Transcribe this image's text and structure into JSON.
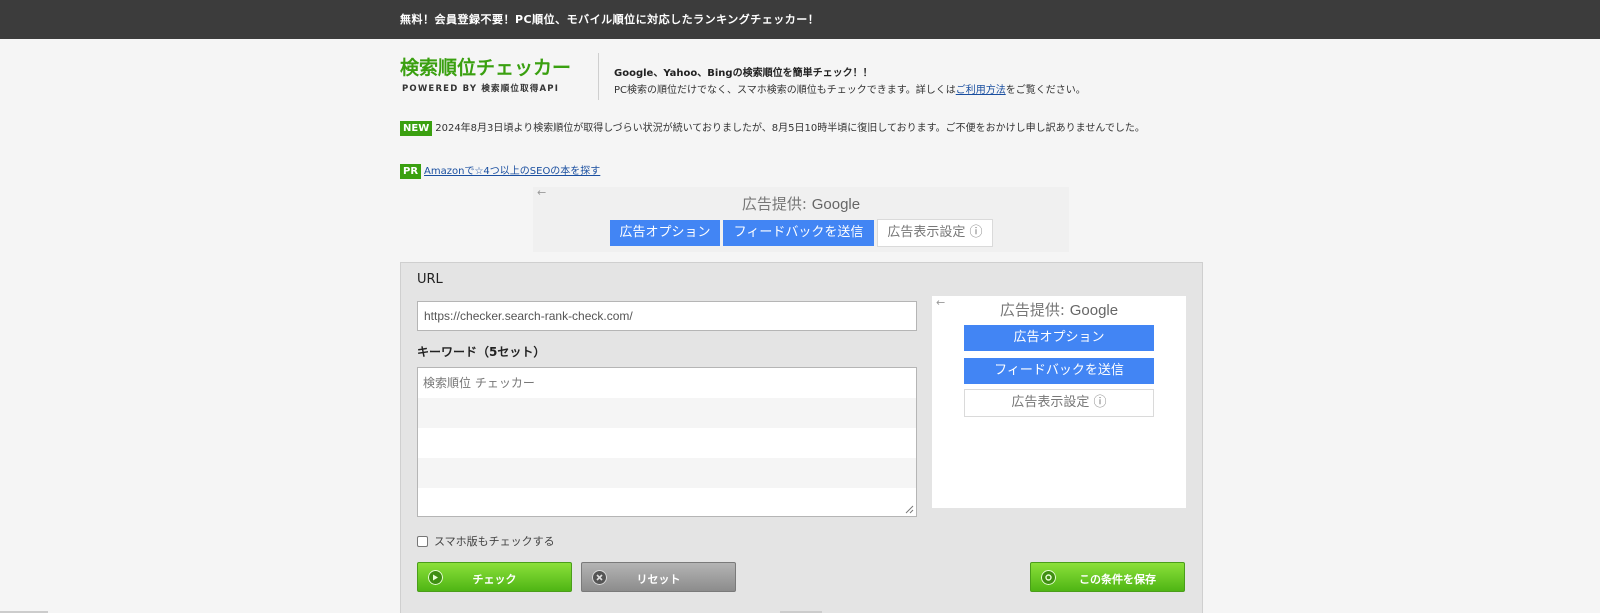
{
  "topbar": {
    "tagline": "無料！会員登録不要！PC順位、モバイル順位に対応したランキングチェッカー！"
  },
  "header": {
    "logo_title": "検索順位チェッカー",
    "logo_subtitle": "POWERED BY 検索順位取得API",
    "desc_line1": "Google、Yahoo、Bingの検索順位を簡単チェック！！",
    "desc_line2_prefix": "PC検索の順位だけでなく、スマホ検索の順位もチェックできます。詳しくは",
    "desc_line2_link": "ご利用方法",
    "desc_line2_suffix": "をご覧ください。"
  },
  "notice": {
    "badge": "NEW",
    "text": "2024年8月3日頃より検索順位が取得しづらい状況が続いておりましたが、8月5日10時半頃に復旧しております。ご不便をおかけし申し訳ありませんでした。"
  },
  "pr": {
    "badge": "PR",
    "link": "Amazonで☆4つ以上のSEOの本を探す"
  },
  "ad_top": {
    "back": "←",
    "provided_prefix": "広告提供: ",
    "provided_brand": "Google",
    "ad_options": "広告オプション",
    "feedback": "フィードバックを送信",
    "display_settings": "広告表示設定 ⓘ"
  },
  "form": {
    "url_label": "URL",
    "url_value": "https://checker.search-rank-check.com/",
    "keyword_label": "キーワード（5セット）",
    "keywords": [
      "検索順位 チェッカー",
      "",
      "",
      "",
      ""
    ],
    "smartphone_check_label": "スマホ版もチェックする",
    "check_button": "チェック",
    "reset_button": "リセット",
    "save_button": "この条件を保存"
  },
  "ad_side": {
    "back": "←",
    "provided_prefix": "広告提供: ",
    "provided_brand": "Google",
    "ad_options": "広告オプション",
    "feedback": "フィードバックを送信",
    "display_settings": "広告表示設定 ⓘ"
  },
  "colors": {
    "brand_green": "#3aa010",
    "ad_blue": "#4285f4",
    "topbar": "#3c3c3c"
  }
}
